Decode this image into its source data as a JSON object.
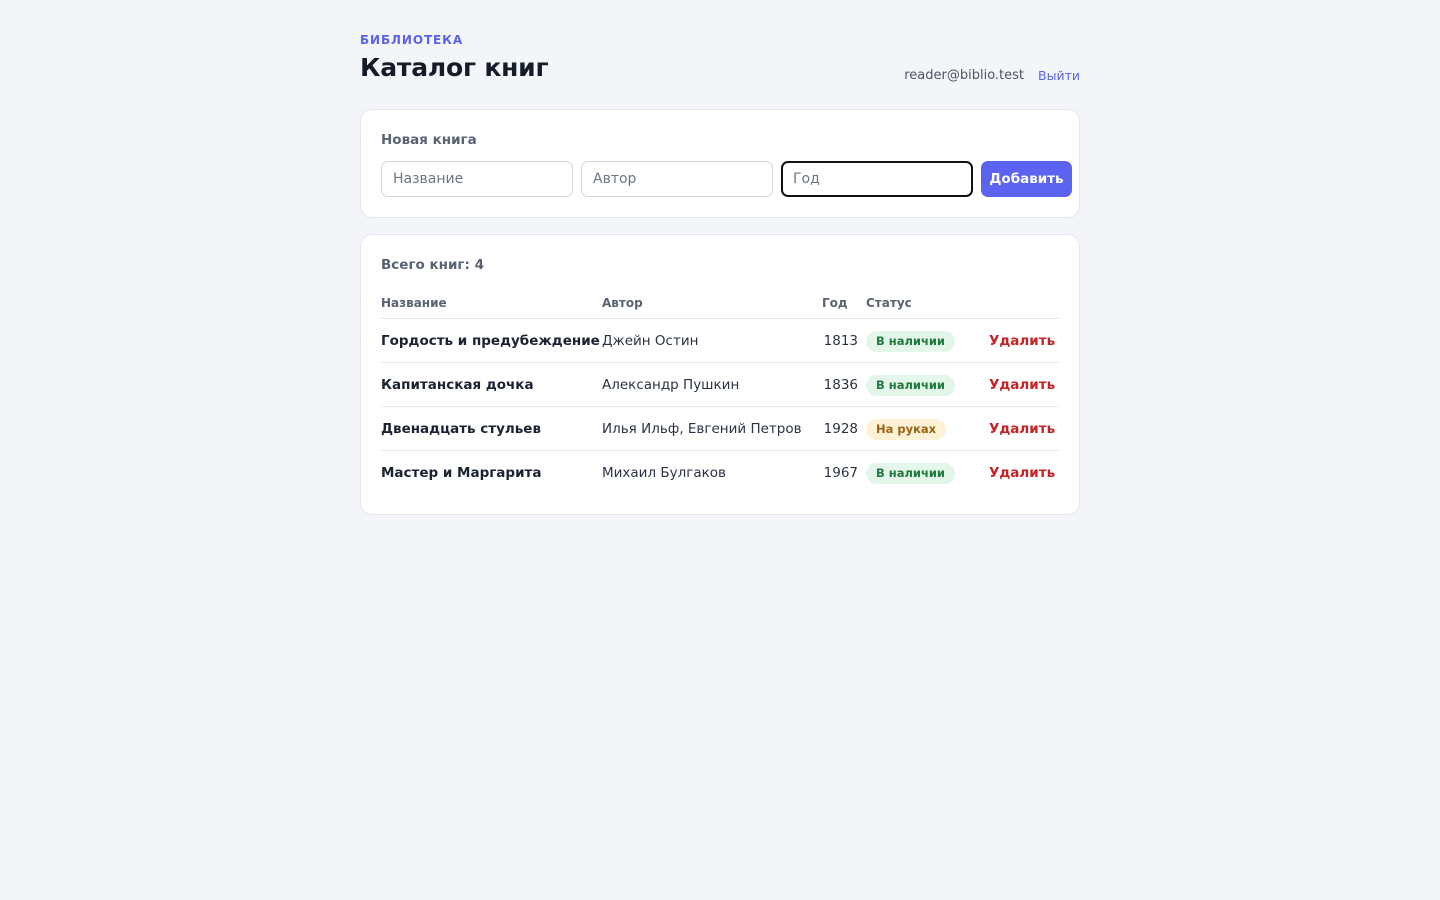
{
  "header": {
    "eyebrow": "БИБЛИОТЕКА",
    "title": "Каталог книг",
    "user_email": "reader@biblio.test",
    "logout_label": "Выйти"
  },
  "form": {
    "title": "Новая книга",
    "title_placeholder": "Название",
    "author_placeholder": "Автор",
    "year_placeholder": "Год",
    "add_label": "Добавить"
  },
  "list": {
    "total_label": "Всего книг: 4",
    "columns": {
      "title": "Название",
      "author": "Автор",
      "year": "Год",
      "status": "Статус"
    },
    "delete_label": "Удалить",
    "rows": [
      {
        "title": "Гордость и предубеждение",
        "author": "Джейн Остин",
        "year": "1813",
        "status": "В наличии",
        "status_kind": "available"
      },
      {
        "title": "Капитанская дочка",
        "author": "Александр Пушкин",
        "year": "1836",
        "status": "В наличии",
        "status_kind": "available"
      },
      {
        "title": "Двенадцать стульев",
        "author": "Илья Ильф, Евгений Петров",
        "year": "1928",
        "status": "На руках",
        "status_kind": "checked-out"
      },
      {
        "title": "Мастер и Маргарита",
        "author": "Михаил Булгаков",
        "year": "1967",
        "status": "В наличии",
        "status_kind": "available"
      }
    ]
  },
  "colors": {
    "accent": "#5b63f0",
    "danger": "#c62424",
    "available_bg": "#e4f6ea",
    "checked_out_bg": "#fdf1d6"
  }
}
